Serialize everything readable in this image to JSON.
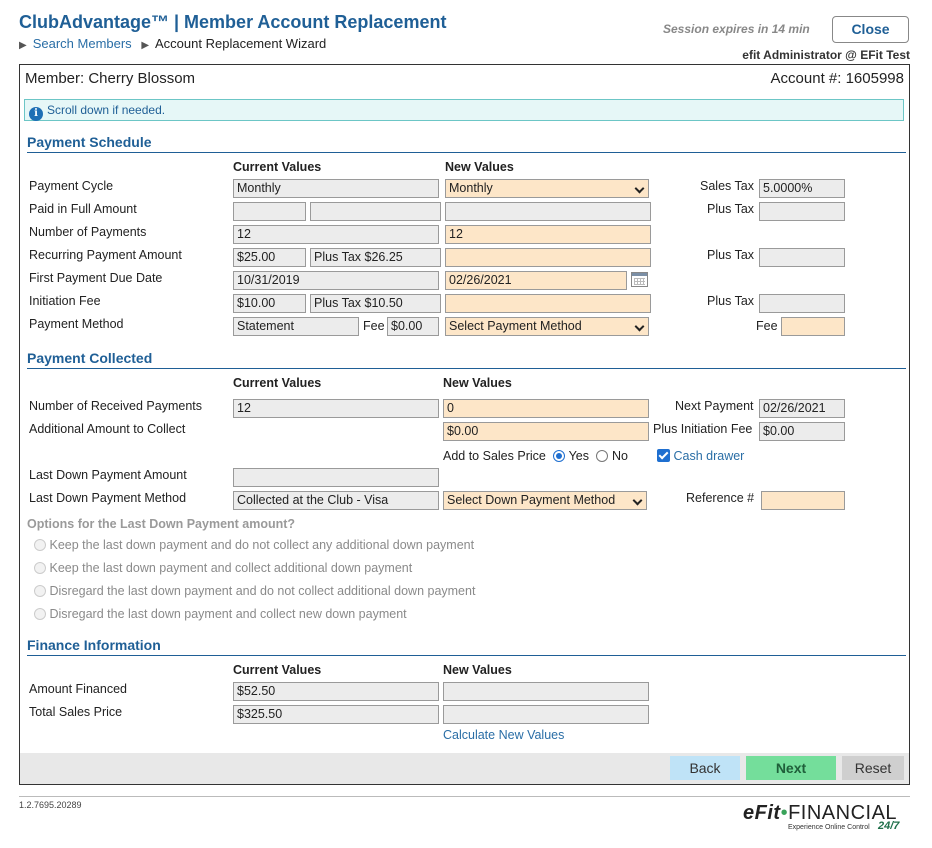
{
  "header": {
    "app_title": "ClubAdvantage™ | Member Account Replacement",
    "breadcrumb": {
      "link": "Search Members",
      "current": "Account Replacement Wizard"
    },
    "session_text": "Session expires in 14 min",
    "close_label": "Close",
    "user_text": "efit Administrator @ EFit Test"
  },
  "member": {
    "name_text": "Member: Cherry Blossom",
    "account_text": "Account #: 1605998"
  },
  "info_text": "Scroll down if needed.",
  "payment_schedule": {
    "title": "Payment Schedule",
    "col_current": "Current Values",
    "col_new": "New Values",
    "rows": {
      "cycle": {
        "label": "Payment Cycle",
        "current": "Monthly",
        "new": "Monthly",
        "side_label": "Sales Tax",
        "side_value": "5.0000%"
      },
      "paid_full": {
        "label": "Paid in Full Amount",
        "current_a": "",
        "current_b": "",
        "new": "",
        "side_label": "Plus Tax",
        "side_value": ""
      },
      "num_payments": {
        "label": "Number of Payments",
        "current": "12",
        "new": "12"
      },
      "recurring": {
        "label": "Recurring Payment Amount",
        "current_a": "$25.00",
        "current_b": "Plus Tax $26.25",
        "new": "",
        "side_label": "Plus Tax",
        "side_value": ""
      },
      "first_due": {
        "label": "First Payment Due Date",
        "current": "10/31/2019",
        "new": "02/26/2021"
      },
      "initiation": {
        "label": "Initiation Fee",
        "current_a": "$10.00",
        "current_b": "Plus Tax $10.50",
        "new": "",
        "side_label": "Plus Tax",
        "side_value": ""
      },
      "method": {
        "label": "Payment Method",
        "current": "Statement",
        "fee_label": "Fee",
        "fee_value": "$0.00",
        "new": "Select Payment Method",
        "side_label": "Fee",
        "side_value": ""
      }
    }
  },
  "payment_collected": {
    "title": "Payment Collected",
    "col_current": "Current Values",
    "col_new": "New Values",
    "received": {
      "label": "Number of Received Payments",
      "current": "12",
      "new": "0",
      "side_label": "Next Payment",
      "side_value": "02/26/2021"
    },
    "additional": {
      "label": "Additional Amount to Collect",
      "new": "$0.00",
      "side_label": "Plus Initiation Fee",
      "side_value": "$0.00"
    },
    "add_to_sales": {
      "label": "Add to Sales Price",
      "yes": "Yes",
      "no": "No",
      "selected": "Yes"
    },
    "cash_drawer": {
      "label": "Cash drawer",
      "checked": true
    },
    "last_down_amount": {
      "label": "Last Down Payment Amount",
      "current": ""
    },
    "last_down_method": {
      "label": "Last Down Payment Method",
      "current": "Collected at the Club - Visa",
      "new": "Select Down Payment Method",
      "side_label": "Reference #",
      "side_value": ""
    },
    "options_title": "Options for the Last Down Payment amount?",
    "options": [
      "Keep the last down payment and do not collect any additional down payment",
      "Keep the last down payment and collect additional down payment",
      "Disregard the last down payment and do not collect additional down payment",
      "Disregard the last down payment and collect new down payment"
    ]
  },
  "finance": {
    "title": "Finance Information",
    "col_current": "Current Values",
    "col_new": "New Values",
    "amount_financed": {
      "label": "Amount Financed",
      "current": "$52.50",
      "new": ""
    },
    "total_sales": {
      "label": "Total Sales Price",
      "current": "$325.50",
      "new": ""
    },
    "calc_link": "Calculate New Values"
  },
  "buttons": {
    "back": "Back",
    "next": "Next",
    "reset": "Reset"
  },
  "footer": {
    "version": "1.2.7695.20289",
    "logo_efit": "eFit",
    "logo_dot": "•",
    "logo_financial": "FINANCIAL",
    "tagline": "Experience Online Control",
    "tag247": "24/7"
  },
  "colors": {
    "brand": "#1f5f96",
    "editable_field": "#fde6c8",
    "readonly_field": "#ececec",
    "next_button": "#74de9b",
    "back_button": "#bfe3f7"
  }
}
